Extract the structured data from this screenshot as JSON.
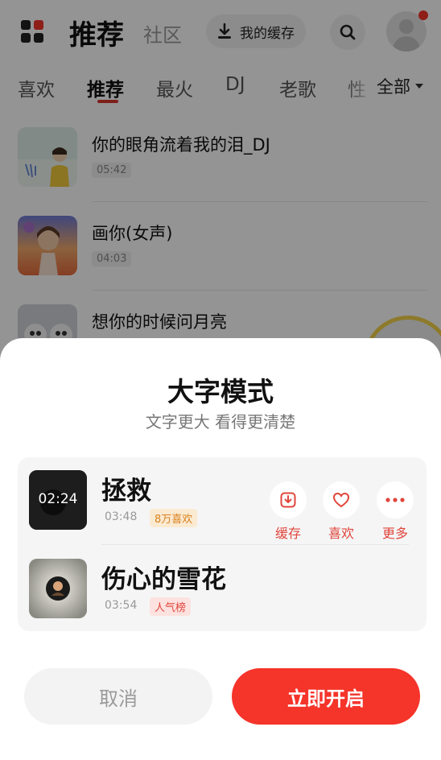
{
  "header": {
    "title": "推荐",
    "subtitle": "社区",
    "cache_button": "我的缓存",
    "search_icon": "search-icon",
    "avatar_icon": "user-avatar",
    "notify_dot_color": "#f5342a"
  },
  "tabs": {
    "items": [
      "喜欢",
      "推荐",
      "最火",
      "DJ",
      "老歌",
      "性"
    ],
    "active": "推荐",
    "all_label": "全部"
  },
  "songs": [
    {
      "title": "你的眼角流着我的泪_DJ",
      "duration": "05:42"
    },
    {
      "title": "画你(女声)",
      "duration": "04:03"
    },
    {
      "title": "想你的时候问月亮",
      "duration": ""
    }
  ],
  "modal": {
    "title": "大字模式",
    "subtitle": "文字更大 看得更清楚",
    "preview": {
      "row1": {
        "title": "拯救",
        "thumb_time": "02:24",
        "duration": "03:48",
        "tag": "8万喜欢"
      },
      "row2": {
        "title": "伤心的雪花",
        "duration": "03:54",
        "tag": "人气榜"
      },
      "actions": [
        {
          "label": "缓存",
          "icon": "download-icon"
        },
        {
          "label": "喜欢",
          "icon": "heart-icon"
        },
        {
          "label": "更多",
          "icon": "more-icon"
        }
      ]
    },
    "cancel_label": "取消",
    "confirm_label": "立即开启",
    "accent_color": "#f5342a"
  }
}
